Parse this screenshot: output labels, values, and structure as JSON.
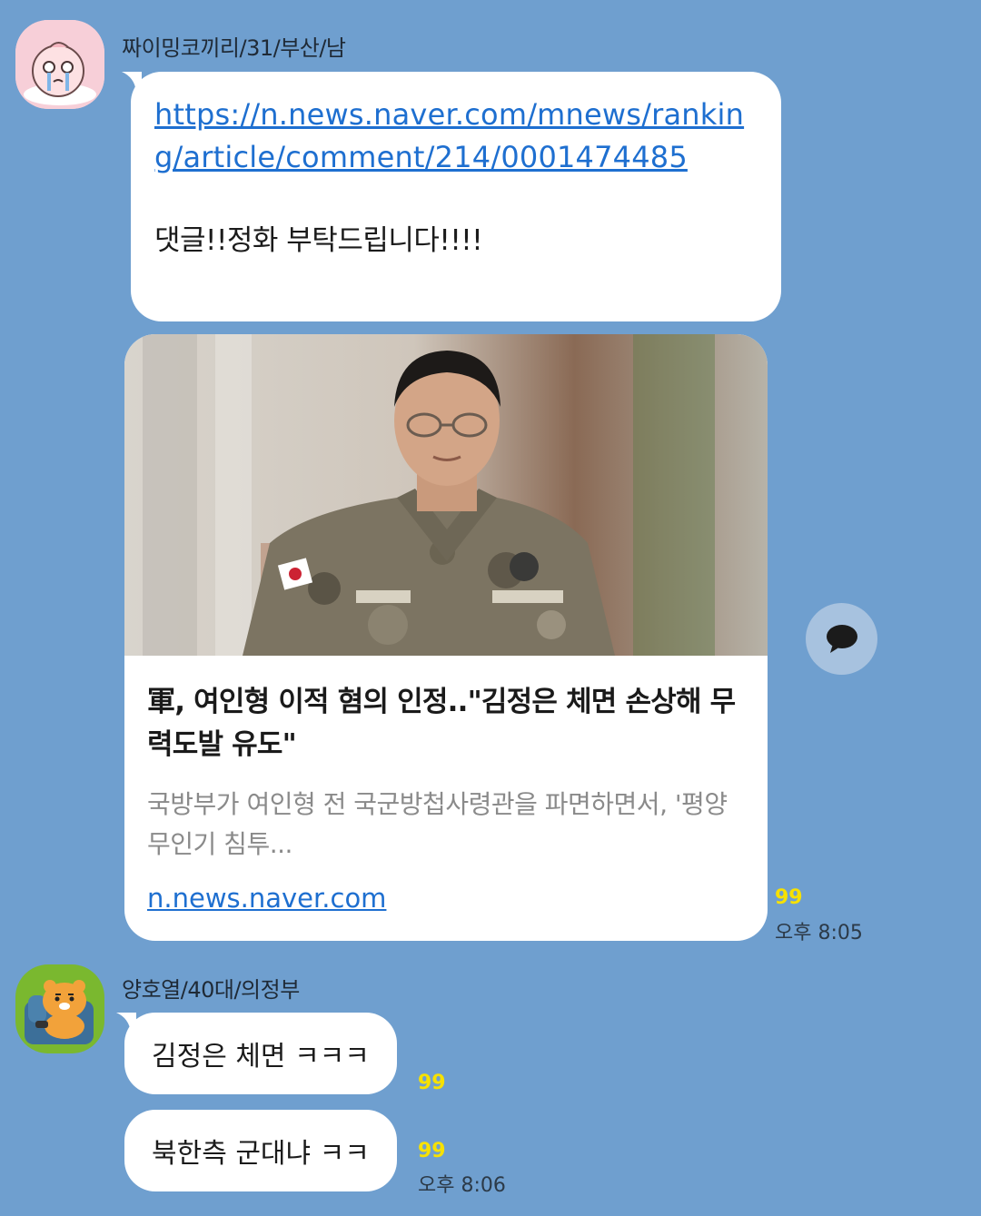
{
  "messages": [
    {
      "sender": "짜이밍코끼리/31/부산/남",
      "link": "https://n.news.naver.com/mnews/ranking/article/comment/214/0001474485",
      "text": "댓글!!정화 부탁드립니다!!!!"
    }
  ],
  "link_card": {
    "title": "軍, 여인형 이적 혐의 인정..\"김정은 체면 손상해 무력도발 유도\"",
    "description": "국방부가 여인형 전 국군방첩사령관을 파면하면서, '평양 무인기 침투...",
    "domain": "n.news.naver.com",
    "unread": "99",
    "time": "오후 8:05"
  },
  "second_user": {
    "sender": "양호열/40대/의정부",
    "msg_a": "김정은 체면 ㅋㅋㅋ",
    "msg_a_unread": "99",
    "msg_b": "북한측 군대냐 ㅋㅋ",
    "msg_b_unread": "99",
    "msg_b_time": "오후 8:06"
  },
  "colors": {
    "background": "#6f9fcf",
    "bubble": "#ffffff",
    "link": "#1e6fd0",
    "unread": "#f7e100"
  },
  "icons": {
    "share": "speech-bubble-icon"
  }
}
